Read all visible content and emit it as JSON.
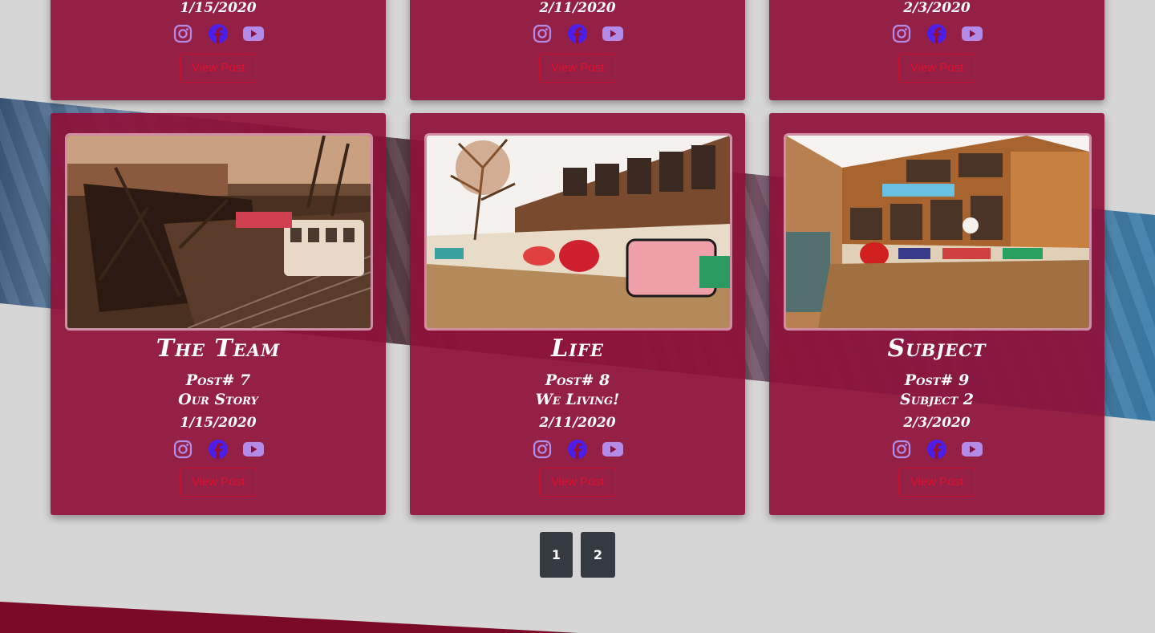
{
  "colors": {
    "card_bg": "#8e1038",
    "accent_red": "#c8102e",
    "icon_purple": "#b38be8",
    "facebook_blue": "#4b1fe8",
    "pagination_bg": "#343a40",
    "page_bg": "#d6d6d6"
  },
  "top_row": [
    {
      "date": "1/15/2020",
      "view_label": "View Post"
    },
    {
      "date": "2/11/2020",
      "view_label": "View Post"
    },
    {
      "date": "2/3/2020",
      "view_label": "View Post"
    }
  ],
  "posts": [
    {
      "title": "The Team",
      "post_no": "Post# 7",
      "subtitle": "Our Story",
      "date": "1/15/2020",
      "view_label": "View Post",
      "image": "subway-graffiti-photo"
    },
    {
      "title": "Life",
      "post_no": "Post# 8",
      "subtitle": "We Living!",
      "date": "2/11/2020",
      "view_label": "View Post",
      "image": "graffiti-wall-photo"
    },
    {
      "title": "Subject",
      "post_no": "Post# 9",
      "subtitle": "Subject 2",
      "date": "2/3/2020",
      "view_label": "View Post",
      "image": "factory-graffiti-photo"
    }
  ],
  "socials": [
    "instagram-icon",
    "facebook-icon",
    "youtube-icon"
  ],
  "pagination": [
    "1",
    "2"
  ]
}
